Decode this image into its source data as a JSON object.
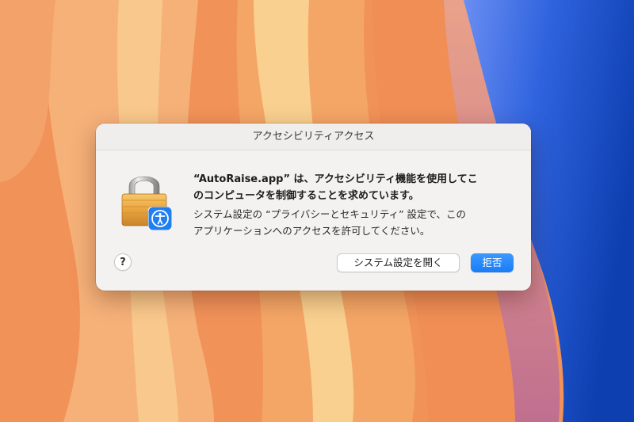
{
  "dialog": {
    "title": "アクセシビリティアクセス",
    "message_line1": "“AutoRaise.app” は、アクセシビリティ機能を使用してこ",
    "message_line2": "のコンピュータを制御することを求めています。",
    "info_line1": "システム設定の “プライバシーとセキュリティ” 設定で、この",
    "info_line2": "アプリケーションへのアクセスを許可してください。",
    "help_label": "?",
    "open_settings_label": "システム設定を開く",
    "deny_label": "拒否"
  },
  "icons": {
    "lock": "lock-icon",
    "badge": "accessibility-icon"
  },
  "colors": {
    "accent": "#1a7df5",
    "dialog_background": "#f4f2f0"
  }
}
